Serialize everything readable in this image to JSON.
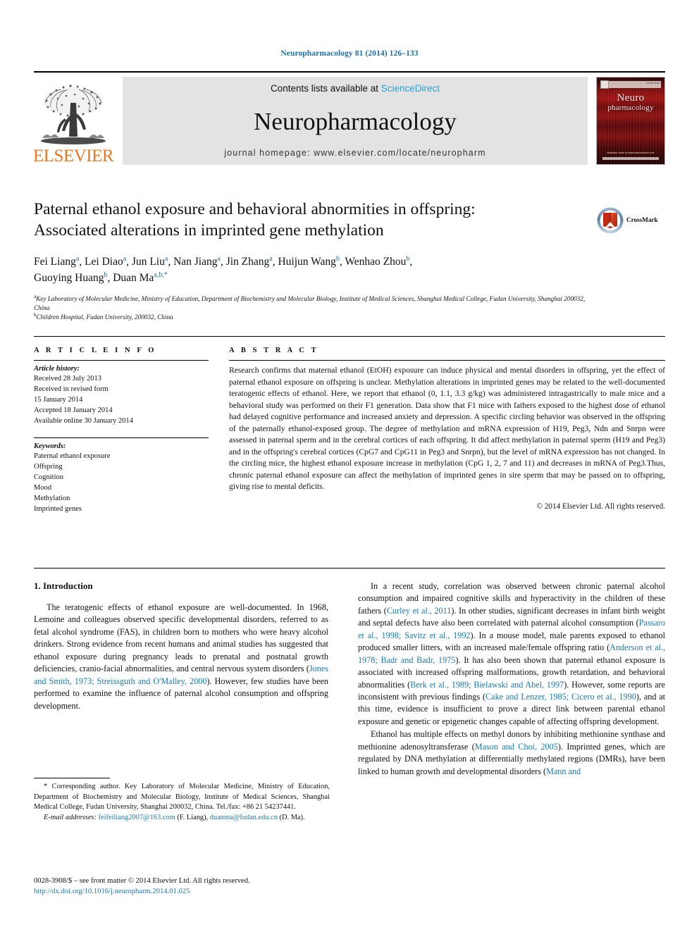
{
  "running_head": "Neuropharmacology 81 (2014) 126–133",
  "masthead": {
    "contents_prefix": "Contents lists available at ",
    "sciencedirect": "ScienceDirect",
    "journal_name": "Neuropharmacology",
    "homepage": "journal homepage: www.elsevier.com/locate/neuropharm",
    "publisher_wordmark": "ELSEVIER",
    "cover": {
      "title_line1": "Neuro",
      "title_line2": "pharmacology",
      "issue_text": "Vol 81 2014",
      "footer_text": "Available online at www.sciencedirect.com"
    }
  },
  "crossmark": {
    "label": "CrossMark"
  },
  "article": {
    "title_line1": "Paternal ethanol exposure and behavioral abnormities in offspring:",
    "title_line2": "Associated alterations in imprinted gene methylation",
    "authors_line1": "Fei Liang a, Lei Diao a, Jun Liu a, Nan Jiang a, Jin Zhang a, Huijun Wang b, Wenhao Zhou b,",
    "authors_line2": "Guoying Huang b, Duan Ma a,b,*",
    "affiliation_a": "Key Laboratory of Molecular Medicine, Ministry of Education, Department of Biochemistry and Molecular Biology, Institute of Medical Sciences, Shanghai Medical College, Fudan University, Shanghai 200032, China",
    "affiliation_b": "Children Hospital, Fudan University, 200032, China"
  },
  "article_info": {
    "heading": "A R T I C L E  I N F O",
    "history_label": "Article history:",
    "history": [
      "Received 28 July 2013",
      "Received in revised form",
      "15 January 2014",
      "Accepted 18 January 2014",
      "Available online 30 January 2014"
    ],
    "keywords_label": "Keywords:",
    "keywords": [
      "Paternal ethanol exposure",
      "Offspring",
      "Cognition",
      "Mood",
      "Methylation",
      "Imprinted genes"
    ]
  },
  "abstract": {
    "heading": "A B S T R A C T",
    "text": "Research confirms that maternal ethanol (EtOH) exposure can induce physical and mental disorders in offspring, yet the effect of paternal ethanol exposure on offspring is unclear. Methylation alterations in imprinted genes may be related to the well-documented teratogenic effects of ethanol. Here, we report that ethanol (0, 1.1, 3.3 g/kg) was administered intragastrically to male mice and a behavioral study was performed on their F1 generation. Data show that F1 mice with fathers exposed to the highest dose of ethanol had delayed cognitive performance and increased anxiety and depression. A specific circling behavior was observed in the offspring of the paternally ethanol-exposed group. The degree of methylation and mRNA expression of H19, Peg3, Ndn and Snrpn were assessed in paternal sperm and in the cerebral cortices of each offspring. It did affect methylation in paternal sperm (H19 and Peg3) and in the offspring's cerebral cortices (CpG7 and CpG11 in Peg3 and Snrpn), but the level of mRNA expression has not changed. In the circling mice, the highest ethanol exposure increase in methylation (CpG 1, 2, 7 and 11) and decreases in mRNA of Peg3.Thus, chronic paternal ethanol exposure can affect the methylation of imprinted genes in sire sperm that may be passed on to offspring, giving rise to mental deficits.",
    "copyright": "© 2014 Elsevier Ltd. All rights reserved."
  },
  "body": {
    "section1_heading": "1. Introduction",
    "left_paragraph1_a": "The teratogenic effects of ethanol exposure are well-documented. In 1968, Lemoine and colleagues observed specific developmental disorders, referred to as fetal alcohol syndrome (FAS), in children born to mothers who were heavy alcohol drinkers. Strong evidence from recent humans and animal studies has suggested that ethanol exposure during pregnancy leads to prenatal and postnatal growth deficiencies, cranio-facial abnormalities, and central nervous system disorders (",
    "left_paragraph1_ref": "Jones and Smith, 1973; Streissguth and O'Malley, 2000",
    "left_paragraph1_b": "). However, few studies have been performed to examine the influence of paternal alcohol consumption and offspring development.",
    "right_p1_t1": "In a recent study, correlation was observed between chronic paternal alcohol consumption and impaired cognitive skills and hyperactivity in the children of these fathers (",
    "right_p1_r1": "Curley et al., 2011",
    "right_p1_t2": "). In other studies, significant decreases in infant birth weight and septal defects have also been correlated with paternal alcohol consumption (",
    "right_p1_r2": "Passaro et al., 1998; Savitz et al., 1992",
    "right_p1_t3": "). In a mouse model, male parents exposed to ethanol produced smaller litters, with an increased male/female offspring ratio (",
    "right_p1_r3": "Anderson et al., 1978; Badr and Badr, 1975",
    "right_p1_t4": "). It has also been shown that paternal ethanol exposure is associated with increased offspring malformations, growth retardation, and behavioral abnormalities (",
    "right_p1_r4": "Berk et al., 1989; Bielawski and Abel, 1997",
    "right_p1_t5": "). However, some reports are inconsistent with previous findings (",
    "right_p1_r5": "Cake and Lenzer, 1985; Cicero et al., 1990",
    "right_p1_t6": "), and at this time, evidence is insufficient to prove a direct link between parental ethanol exposure and genetic or epigenetic changes capable of affecting offspring development.",
    "right_p2_t1": "Ethanol has multiple effects on methyl donors by inhibiting methionine synthase and methionine adenosyltransferase (",
    "right_p2_r1": "Mason and Choi, 2005",
    "right_p2_t2": "). Imprinted genes, which are regulated by DNA methylation at differentially methylated regions (DMRs), have been linked to human growth and developmental disorders (",
    "right_p2_r2": "Mann and"
  },
  "footnotes": {
    "corresponding": "* Corresponding author. Key Laboratory of Molecular Medicine, Ministry of Education, Department of Biochemistry and Molecular Biology, Institute of Medical Sciences, Shanghai Medical College, Fudan University, Shanghai 200032, China. Tel./fax: +86 21 54237441.",
    "email_label": "E-mail addresses:",
    "email1": "feifeiliang2007@163.com",
    "email1_owner": "(F. Liang),",
    "email2": "duanma@fudan.edu.cn",
    "email2_owner": "(D. Ma)."
  },
  "imprint": {
    "line1": "0028-3908/$ – see front matter © 2014 Elsevier Ltd. All rights reserved.",
    "doi": "http://dx.doi.org/10.1016/j.neuropharm.2014.01.025"
  }
}
